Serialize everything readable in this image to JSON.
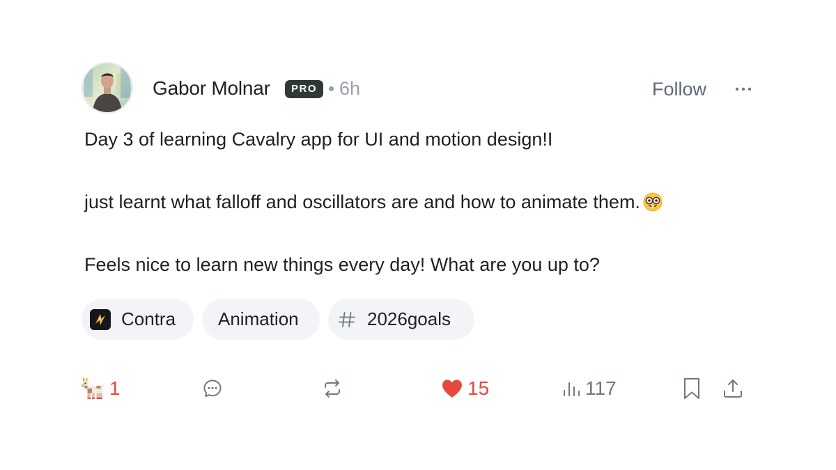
{
  "author": {
    "name": "Gabor Molnar",
    "badge": "PRO",
    "separator": "•",
    "time": "6h"
  },
  "header": {
    "follow_label": "Follow",
    "more_icon": "more-horizontal-icon"
  },
  "post": {
    "line1": "Day 3 of learning Cavalry app for UI and motion design!I",
    "line2": "just learnt what falloff and oscillators are and how to animate them.",
    "line2_emoji": "nerd-face-emoji",
    "line3": "Feels nice to learn new things every day! What are you up to?"
  },
  "tags": [
    {
      "label": "Contra",
      "icon": "contra-logo-icon"
    },
    {
      "label": "Animation",
      "icon": ""
    },
    {
      "label": "2026goals",
      "icon": "hashtag-icon"
    }
  ],
  "actions": {
    "goat_count": "1",
    "like_count": "15",
    "views_count": "117"
  },
  "colors": {
    "accent_red": "#e5483d",
    "badge_bg": "#2f3a34",
    "tag_bg": "#f3f4f7",
    "muted_text": "#9aa0ab",
    "icon_gray": "#6f7685"
  }
}
